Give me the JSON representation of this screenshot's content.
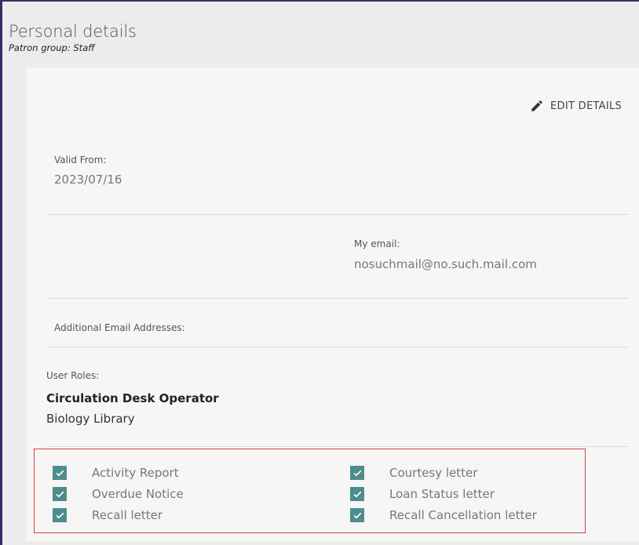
{
  "header": {
    "title": "Personal details",
    "subtitle": "Patron group: Staff"
  },
  "actions": {
    "edit_label": "EDIT DETAILS"
  },
  "fields": {
    "valid_from_label": "Valid From:",
    "valid_from_value": "2023/07/16",
    "email_label": "My email:",
    "email_value": "nosuchmail@no.such.mail.com",
    "additional_emails_label": "Additional Email Addresses:"
  },
  "roles": {
    "label": "User Roles:",
    "title": "Circulation Desk Operator",
    "library": "Biology Library"
  },
  "notifications": {
    "left": [
      {
        "label": "Activity Report",
        "checked": true
      },
      {
        "label": "Overdue Notice",
        "checked": true
      },
      {
        "label": "Recall letter",
        "checked": true
      }
    ],
    "right": [
      {
        "label": "Courtesy letter",
        "checked": true
      },
      {
        "label": "Loan Status letter",
        "checked": true
      },
      {
        "label": "Recall Cancellation letter",
        "checked": true
      }
    ]
  },
  "colors": {
    "checkbox": "#4f8c8c",
    "highlight_border": "#e04040",
    "frame_border": "#3b2a66"
  },
  "icons": {
    "edit": "pencil-icon",
    "checkbox": "checkmark-icon"
  }
}
